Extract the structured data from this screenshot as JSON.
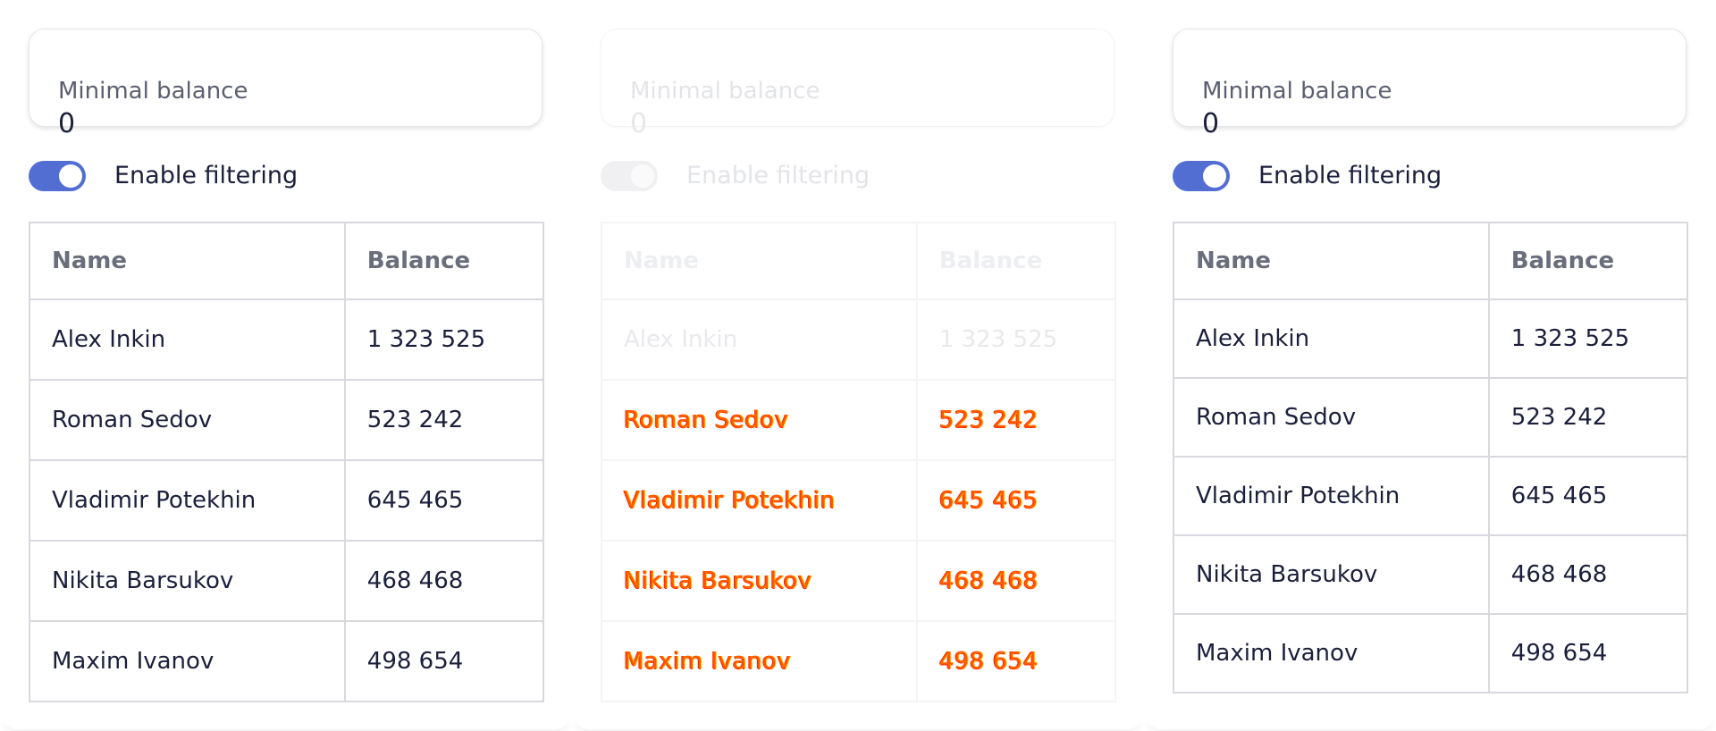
{
  "panels": [
    {
      "field": {
        "label": "Minimal balance",
        "value": "0"
      },
      "toggle": {
        "label": "Enable filtering",
        "on": true
      },
      "table": {
        "headers": [
          "Name",
          "Balance"
        ],
        "rows": [
          [
            "Alex Inkin",
            "1 323 525"
          ],
          [
            "Roman Sedov",
            "523 242"
          ],
          [
            "Vladimir Potekhin",
            "645 465"
          ],
          [
            "Nikita Barsukov",
            "468 468"
          ],
          [
            "Maxim Ivanov",
            "498 654"
          ]
        ]
      }
    },
    {
      "state": "disabled",
      "field": {
        "label": "Minimal balance",
        "value": "0"
      },
      "toggle": {
        "label": "Enable filtering",
        "on": false
      },
      "table": {
        "headers": [
          "Name",
          "Balance"
        ],
        "rows": [
          [
            "Alex Inkin",
            "1 323 525"
          ],
          [
            "Roman Sedov",
            "523 242"
          ],
          [
            "Vladimir Potekhin",
            "645 465"
          ],
          [
            "Nikita Barsukov",
            "468 468"
          ],
          [
            "Maxim Ivanov",
            "498 654"
          ]
        ]
      }
    },
    {
      "field": {
        "label": "Minimal balance",
        "value": "0"
      },
      "toggle": {
        "label": "Enable filtering",
        "on": true
      },
      "table": {
        "headers": [
          "Name",
          "Balance"
        ],
        "rows": [
          [
            "Alex Inkin",
            "1 323 525"
          ],
          [
            "Roman Sedov",
            "523 242"
          ],
          [
            "Vladimir Potekhin",
            "645 465"
          ],
          [
            "Nikita Barsukov",
            "468 468"
          ],
          [
            "Maxim Ivanov",
            "498 654"
          ]
        ]
      }
    }
  ],
  "colors": {
    "accent": "#526ed3",
    "text": "#1b1f3b",
    "header_text": "#6a6d7c",
    "border": "#d8d9de",
    "glitch": "#ff5a00"
  }
}
